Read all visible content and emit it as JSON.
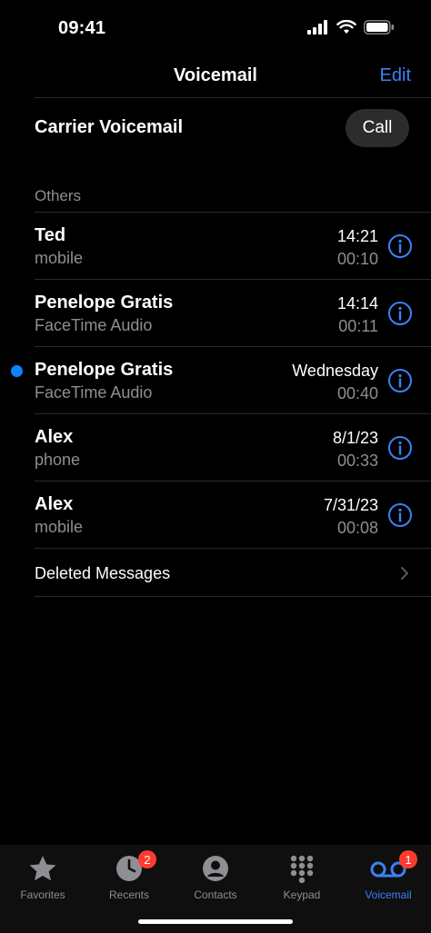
{
  "status_bar": {
    "time": "09:41"
  },
  "nav": {
    "title": "Voicemail",
    "edit_label": "Edit"
  },
  "carrier": {
    "label": "Carrier Voicemail",
    "call_label": "Call"
  },
  "section": {
    "header": "Others"
  },
  "voicemails": [
    {
      "name": "Ted",
      "subtitle": "mobile",
      "date": "14:21",
      "duration": "00:10",
      "unread": false
    },
    {
      "name": "Penelope Gratis",
      "subtitle": "FaceTime Audio",
      "date": "14:14",
      "duration": "00:11",
      "unread": false
    },
    {
      "name": "Penelope Gratis",
      "subtitle": "FaceTime Audio",
      "date": "Wednesday",
      "duration": "00:40",
      "unread": true
    },
    {
      "name": "Alex",
      "subtitle": "phone",
      "date": "8/1/23",
      "duration": "00:33",
      "unread": false
    },
    {
      "name": "Alex",
      "subtitle": "mobile",
      "date": "7/31/23",
      "duration": "00:08",
      "unread": false
    }
  ],
  "deleted": {
    "label": "Deleted Messages"
  },
  "tabs": [
    {
      "label": "Favorites",
      "icon": "star-icon",
      "badge": "",
      "active": false
    },
    {
      "label": "Recents",
      "icon": "clock-icon",
      "badge": "2",
      "active": false
    },
    {
      "label": "Contacts",
      "icon": "person-icon",
      "badge": "",
      "active": false
    },
    {
      "label": "Keypad",
      "icon": "keypad-icon",
      "badge": "",
      "active": false
    },
    {
      "label": "Voicemail",
      "icon": "voicemail-icon",
      "badge": "1",
      "active": true
    }
  ],
  "colors": {
    "accent": "#3b82f6",
    "unread_dot": "#0a84ff",
    "badge": "#ff3b30",
    "secondary_text": "#8e8e93"
  }
}
